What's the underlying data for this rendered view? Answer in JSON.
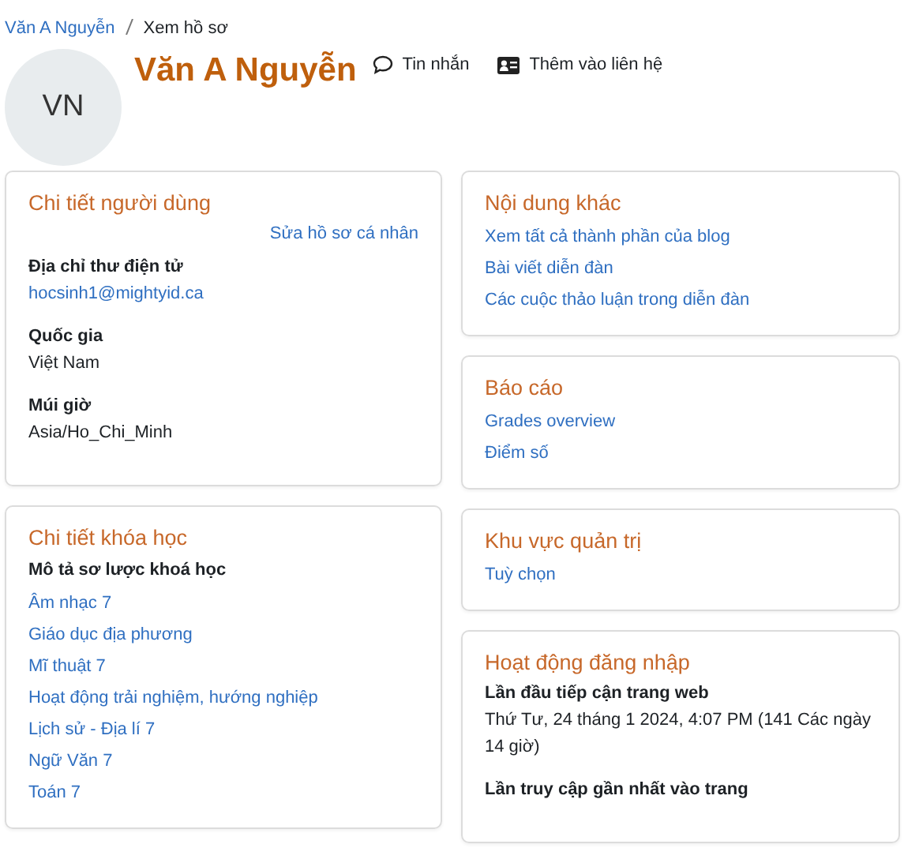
{
  "breadcrumb": [
    {
      "label": "Văn A Nguyễn",
      "kind": "link"
    },
    {
      "label": "Xem hồ sơ",
      "kind": "current"
    }
  ],
  "profile": {
    "initials": "VN",
    "name": "Văn A Nguyễn",
    "actions": [
      {
        "label": "Tin nhắn"
      },
      {
        "label": "Thêm vào liên hệ"
      }
    ]
  },
  "left_column": [
    {
      "title": "Chi tiết người dùng",
      "action": "Sửa hồ sơ cá nhân",
      "items": [
        {
          "kind": "link_field",
          "label": "Địa chỉ thư điện tử",
          "value": "hocsinh1@mightyid.ca"
        },
        {
          "kind": "field",
          "label": "Quốc gia",
          "value": "Việt Nam"
        },
        {
          "kind": "field",
          "label": "Múi giờ",
          "value": "Asia/Ho_Chi_Minh"
        }
      ]
    },
    {
      "title": "Chi tiết khóa học",
      "items": [
        {
          "kind": "subheading",
          "text": "Mô tả sơ lược khoá học"
        },
        {
          "kind": "link",
          "text": "Âm nhạc 7"
        },
        {
          "kind": "link",
          "text": "Giáo dục địa phương"
        },
        {
          "kind": "link",
          "text": "Mĩ thuật 7"
        },
        {
          "kind": "link",
          "text": "Hoạt động trải nghiệm, hướng nghiệp"
        },
        {
          "kind": "link",
          "text": "Lịch sử - Địa lí 7"
        },
        {
          "kind": "link",
          "text": "Ngữ Văn 7"
        },
        {
          "kind": "link",
          "text": "Toán 7"
        }
      ]
    }
  ],
  "right_column": [
    {
      "title": "Nội dung khác",
      "items": [
        {
          "kind": "link",
          "text": "Xem tất cả thành phần của blog"
        },
        {
          "kind": "link",
          "text": "Bài viết diễn đàn"
        },
        {
          "kind": "link",
          "text": "Các cuộc thảo luận trong diễn đàn"
        }
      ]
    },
    {
      "title": "Báo cáo",
      "items": [
        {
          "kind": "link",
          "text": "Grades overview"
        },
        {
          "kind": "link",
          "text": "Điểm số"
        }
      ]
    },
    {
      "title": "Khu vực quản trị",
      "items": [
        {
          "kind": "link",
          "text": "Tuỳ chọn"
        }
      ]
    },
    {
      "title": "Hoạt động đăng nhập",
      "items": [
        {
          "kind": "field",
          "label": "Lần đầu tiếp cận trang web",
          "value": "Thứ Tư, 24 tháng 1 2024, 4:07 PM  (141 Các ngày 14 giờ)"
        },
        {
          "kind": "field",
          "label": "Lần truy cập gần nhất vào trang"
        }
      ]
    }
  ]
}
